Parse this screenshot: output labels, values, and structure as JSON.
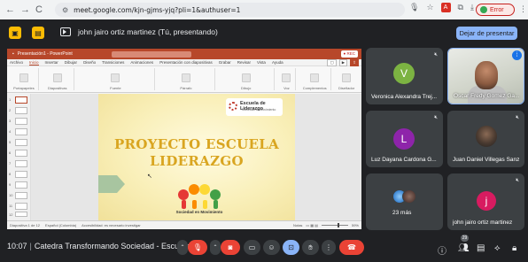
{
  "browser": {
    "back": "←",
    "forward": "→",
    "reload": "C",
    "url": "meet.google.com/kjn-gjms-yjq?pli=1&authuser=1",
    "error_label": "Error"
  },
  "topbar": {
    "presenting_text": "john jairo ortiz martinez (Tú, presentando)",
    "stop_button": "Dejar de presentar"
  },
  "ppt": {
    "window_title": "Presentación1 - PowerPoint",
    "tabs": [
      "Archivo",
      "Inicio",
      "Insertar",
      "Dibujar",
      "Diseño",
      "Transiciones",
      "Animaciones",
      "Presentación con diapositivas",
      "Grabar",
      "Revisar",
      "Vista",
      "Ayuda"
    ],
    "ribbon_groups": [
      "Portapapeles",
      "Diapositivas",
      "Fuente",
      "Párrafo",
      "Dibujo",
      "Voz",
      "Complementos",
      "Diseñador"
    ],
    "slide_numbers": [
      "1",
      "2",
      "3",
      "4",
      "5",
      "6",
      "7",
      "8",
      "9",
      "10",
      "11",
      "12"
    ],
    "slide": {
      "logo_top_title": "Escuela de Liderazgo",
      "logo_top_sub": "Sociedad en Movimiento",
      "title_line1": "PROYECTO ESCUELA",
      "title_line2": "LIDERAZGO",
      "logo_caption": "Sociedad en Movimiento"
    },
    "status": {
      "slide_of": "Diapositiva 1 de 12",
      "language": "Español (Colombia)",
      "accessibility": "Accesibilidad: es necesario investigar",
      "notes": "Notas",
      "zoom": "59%"
    }
  },
  "participants": [
    {
      "name": "Veronica Alexandra Trej...",
      "initial": "V",
      "color": "#7cb342"
    },
    {
      "name": "Oscar Fredy Gomez Ga...",
      "initial": "",
      "color": ""
    },
    {
      "name": "Luz Dayana Cardona G...",
      "initial": "L",
      "color": "#8e24aa"
    },
    {
      "name": "Juan Daniel Villegas Sanz",
      "initial": "",
      "color": ""
    },
    {
      "name": "23 más",
      "initial": "",
      "color": ""
    },
    {
      "name": "john jairo ortiz martinez",
      "initial": "j",
      "color": "#d81b60"
    }
  ],
  "bottombar": {
    "time": "10:07",
    "meeting_title": "Catedra Transformando Sociedad - Escuela...",
    "participant_count": "29"
  }
}
